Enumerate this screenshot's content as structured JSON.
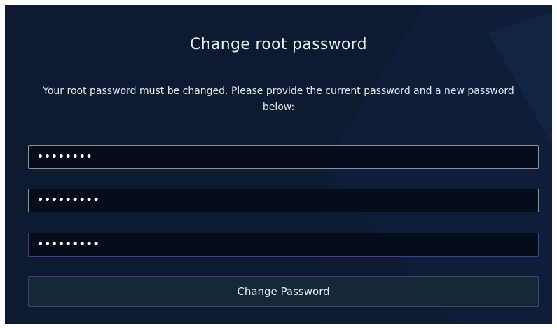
{
  "dialog": {
    "title": "Change root password",
    "message": "Your root password must be changed. Please provide the current password and a new password below:"
  },
  "fields": {
    "current_password": {
      "value": "••••••••"
    },
    "new_password": {
      "value": "•••••••••"
    },
    "confirm_password": {
      "value": "•••••••••"
    }
  },
  "buttons": {
    "submit_label": "Change Password"
  },
  "colors": {
    "panel_background": "#0d1a30",
    "field_background": "#060d1a",
    "button_background": "#14283a",
    "focused_border": "#4b3d8a"
  }
}
